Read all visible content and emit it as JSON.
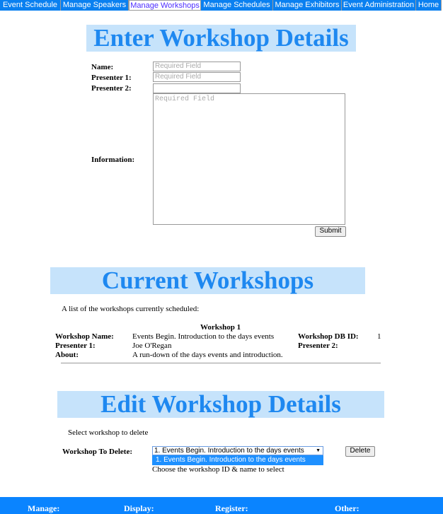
{
  "nav": [
    "Event Schedule",
    "Manage Speakers",
    "Manage Workshops",
    "Manage Schedules",
    "Manage Exhibitors",
    "Event Administration",
    "Home"
  ],
  "enter": {
    "title": "Enter Workshop Details",
    "name_label": "Name:",
    "presenter1_label": "Presenter 1:",
    "presenter2_label": "Presenter 2:",
    "info_label": "Information:",
    "placeholder": "Required Field",
    "submit": "Submit"
  },
  "current": {
    "title": "Current Workshops",
    "intro": "A list of the workshops currently scheduled:",
    "workshop_title": "Workshop 1",
    "name_label": "Workshop Name:",
    "name_value": "Events Begin. Introduction to the days events",
    "id_label": "Workshop DB ID:",
    "id_value": "1",
    "p1_label": "Presenter 1:",
    "p1_value": "Joe O'Regan",
    "p2_label": "Presenter 2:",
    "about_label": "About:",
    "about_value": "A run-down of the days events and introduction."
  },
  "edit": {
    "title": "Edit Workshop Details",
    "intro": "Select workshop to delete",
    "label": "Workshop To Delete:",
    "selected": "1. Events Begin. Introduction to the days events",
    "option": "1. Events Begin. Introduction to the days events",
    "hint": "Choose the workshop ID & name to select",
    "delete": "Delete"
  },
  "footer": [
    "Manage:",
    "Display:",
    "Register:",
    "Other:"
  ],
  "colors": {
    "nav": "#0a80f0",
    "heading_bg": "#c6e3fb",
    "heading_text": "#1e88f0",
    "footer": "#0a84ff"
  }
}
